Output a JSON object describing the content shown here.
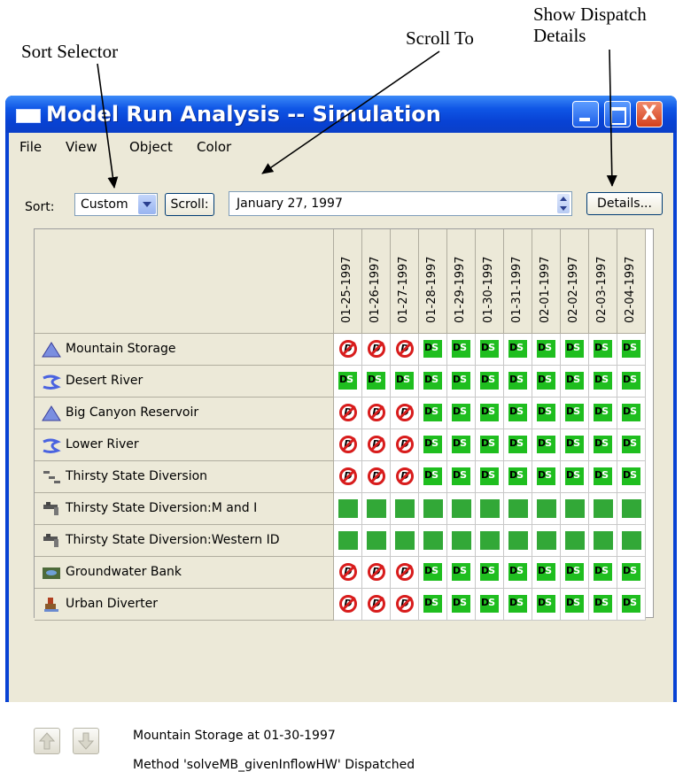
{
  "annotations": {
    "sort_selector": "Sort Selector",
    "scroll_to": "Scroll To",
    "show_dispatch_line1": "Show Dispatch",
    "show_dispatch_line2": "Details"
  },
  "window": {
    "title": "Model Run Analysis -- Simulation",
    "close_glyph": "X"
  },
  "menu": [
    "File",
    "View",
    "Object",
    "Color"
  ],
  "toolbar": {
    "sort_label": "Sort:",
    "sort_value": "Custom",
    "scroll_button": "Scroll:",
    "date_value": "January 27, 1997",
    "details_button": "Details..."
  },
  "columns": [
    "01-25-1997",
    "01-26-1997",
    "01-27-1997",
    "01-28-1997",
    "01-29-1997",
    "01-30-1997",
    "01-31-1997",
    "02-01-1997",
    "02-02-1997",
    "02-03-1997",
    "02-04-1997"
  ],
  "rows": [
    {
      "name": "Mountain Storage",
      "icon": "reservoir-icon",
      "cells": [
        "stop",
        "stop",
        "stop",
        "ds",
        "ds",
        "ds",
        "ds",
        "ds",
        "ds",
        "ds",
        "ds"
      ]
    },
    {
      "name": "Desert River",
      "icon": "river-icon",
      "cells": [
        "ds",
        "ds",
        "ds",
        "ds",
        "ds",
        "ds",
        "ds",
        "ds",
        "ds",
        "ds",
        "ds"
      ]
    },
    {
      "name": "Big Canyon Reservoir",
      "icon": "reservoir-icon",
      "cells": [
        "stop",
        "stop",
        "stop",
        "ds",
        "ds",
        "ds",
        "ds",
        "ds",
        "ds",
        "ds",
        "ds"
      ]
    },
    {
      "name": "Lower River",
      "icon": "river-icon",
      "cells": [
        "stop",
        "stop",
        "stop",
        "ds",
        "ds",
        "ds",
        "ds",
        "ds",
        "ds",
        "ds",
        "ds"
      ]
    },
    {
      "name": "Thirsty State Diversion",
      "icon": "diversion-icon",
      "cells": [
        "stop",
        "stop",
        "stop",
        "ds",
        "ds",
        "ds",
        "ds",
        "ds",
        "ds",
        "ds",
        "ds"
      ]
    },
    {
      "name": "Thirsty State Diversion:M and I",
      "icon": "faucet-icon",
      "cells": [
        "green",
        "green",
        "green",
        "green",
        "green",
        "green",
        "green",
        "green",
        "green",
        "green",
        "green"
      ]
    },
    {
      "name": "Thirsty State Diversion:Western ID",
      "icon": "faucet-icon",
      "cells": [
        "green",
        "green",
        "green",
        "green",
        "green",
        "green",
        "green",
        "green",
        "green",
        "green",
        "green"
      ]
    },
    {
      "name": "Groundwater Bank",
      "icon": "groundwater-icon",
      "cells": [
        "stop",
        "stop",
        "stop",
        "ds",
        "ds",
        "ds",
        "ds",
        "ds",
        "ds",
        "ds",
        "ds"
      ]
    },
    {
      "name": "Urban Diverter",
      "icon": "diverter-icon",
      "cells": [
        "stop",
        "stop",
        "stop",
        "ds",
        "ds",
        "ds",
        "ds",
        "ds",
        "ds",
        "ds",
        "ds"
      ]
    }
  ],
  "cell_glyphs": {
    "ds": "DS",
    "stop": "D"
  },
  "status": {
    "line1": "Mountain Storage at 01-30-1997",
    "line2": "Method 'solveMB_givenInflowHW' Dispatched"
  },
  "colors": {
    "ds_green": "#1fbe1f",
    "stop_red": "#d81c1c",
    "title_blue": "#0842d4"
  }
}
